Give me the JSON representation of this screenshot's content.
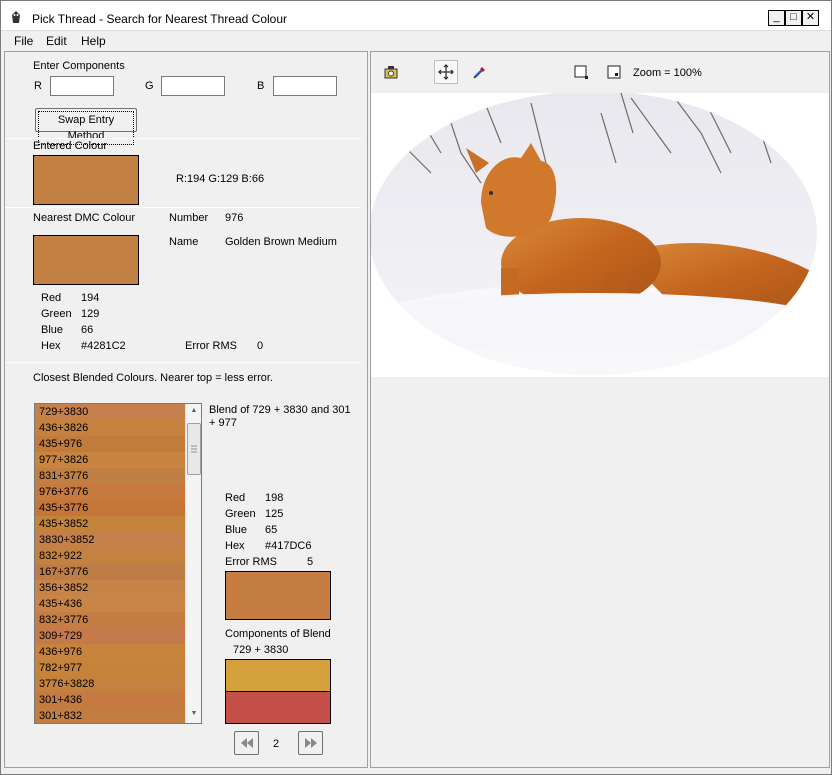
{
  "window": {
    "title": "Pick Thread - Search for Nearest Thread Colour",
    "min_label": "_",
    "max_label": "□",
    "close_label": "✕"
  },
  "menu": {
    "file": "File",
    "edit": "Edit",
    "help": "Help"
  },
  "components": {
    "heading": "Enter Components",
    "r_label": "R",
    "g_label": "G",
    "b_label": "B",
    "r_value": "",
    "g_value": "",
    "b_value": "",
    "swap_button": "Swap Entry Method"
  },
  "entered": {
    "heading": "Entered Colour",
    "color": "#c28142",
    "rgb_text": "R:194 G:129 B:66"
  },
  "nearest": {
    "heading": "Nearest DMC Colour",
    "number_label": "Number",
    "number_value": "976",
    "name_label": "Name",
    "name_value": "Golden Brown Medium",
    "color": "#c28142",
    "red_label": "Red",
    "red_value": "194",
    "green_label": "Green",
    "green_value": "129",
    "blue_label": "Blue",
    "blue_value": "66",
    "hex_label": "Hex",
    "hex_value": "#4281C2",
    "error_label": "Error RMS",
    "error_value": "0"
  },
  "blended": {
    "heading": "Closest Blended Colours. Nearer top = less error.",
    "items": [
      {
        "label": "729+3830",
        "color": "#c6804c"
      },
      {
        "label": "436+3826",
        "color": "#c6813f"
      },
      {
        "label": "435+976",
        "color": "#c17b3a"
      },
      {
        "label": "977+3826",
        "color": "#c9843f"
      },
      {
        "label": "831+3776",
        "color": "#c08043"
      },
      {
        "label": "976+3776",
        "color": "#c67a40"
      },
      {
        "label": "435+3776",
        "color": "#c57537"
      },
      {
        "label": "435+3852",
        "color": "#c3833a"
      },
      {
        "label": "3830+3852",
        "color": "#c5804a"
      },
      {
        "label": "832+922",
        "color": "#c38240"
      },
      {
        "label": "167+3776",
        "color": "#be7c46"
      },
      {
        "label": "356+3852",
        "color": "#c78448"
      },
      {
        "label": "435+436",
        "color": "#c88546"
      },
      {
        "label": "832+3776",
        "color": "#c47e43"
      },
      {
        "label": "309+729",
        "color": "#c47a4a"
      },
      {
        "label": "436+976",
        "color": "#c8833f"
      },
      {
        "label": "782+977",
        "color": "#c5843a"
      },
      {
        "label": "3776+3828",
        "color": "#c5823f"
      },
      {
        "label": "301+436",
        "color": "#c57a42"
      },
      {
        "label": "301+832",
        "color": "#c17e40"
      }
    ],
    "selected_title": "Blend of 729 + 3830 and 301 + 977",
    "color": "#c67d41",
    "red_label": "Red",
    "red_value": "198",
    "green_label": "Green",
    "green_value": "125",
    "blue_label": "Blue",
    "blue_value": "65",
    "hex_label": "Hex",
    "hex_value": "#417DC6",
    "error_label": "Error RMS",
    "error_value": "5",
    "components_heading": "Components of Blend",
    "components_text": "729 + 3830",
    "component_colors": [
      "#d4a13c",
      "#c5504a"
    ],
    "page": "2"
  },
  "toolbar": {
    "zoom_text": "Zoom = 100%"
  },
  "icons": {
    "app": "app-icon",
    "camera": "camera-icon",
    "move": "move-icon",
    "eyedropper": "eyedropper-icon",
    "zoom_fit": "zoom-fit-icon",
    "zoom_actual": "zoom-actual-icon",
    "prev": "rewind-icon",
    "next": "fast-forward-icon"
  }
}
